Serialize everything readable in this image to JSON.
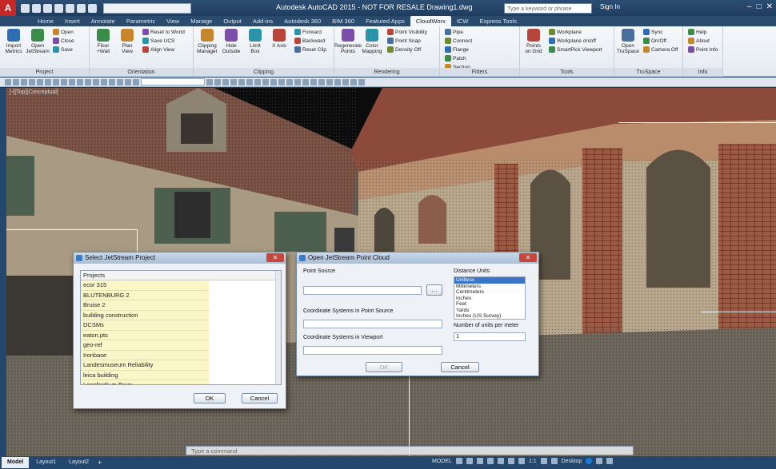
{
  "titlebar": {
    "app_letter": "A",
    "title": "Autodesk AutoCAD 2015 - NOT FOR RESALE   Drawing1.dwg",
    "search_placeholder": "Type a keyword or phrase",
    "signin": "Sign In"
  },
  "tabs": [
    "Home",
    "Insert",
    "Annotate",
    "Parametric",
    "View",
    "Manage",
    "Output",
    "Add-ins",
    "Autodesk 360",
    "BIM 360",
    "Featured Apps",
    "CloudWorx",
    "ICW",
    "Express Tools"
  ],
  "active_tab": "CloudWorx",
  "ribbon": {
    "groups": [
      {
        "title": "Project",
        "big": [
          "Import Metrics",
          "Open JetStream"
        ],
        "small": [
          "Open",
          "Close",
          "Save"
        ]
      },
      {
        "title": "Orientation",
        "big": [
          "Floor +Wall",
          "Plan View"
        ],
        "small": [
          "Reset to World",
          "Save UCS",
          "Align View"
        ]
      },
      {
        "title": "Clipping",
        "big": [
          "Clipping Manager",
          "Hide Outside",
          "Limit Box",
          "X Axis"
        ],
        "small": [
          "Forward",
          "Backward",
          "Reset Clip"
        ]
      },
      {
        "title": "Rendering",
        "big": [
          "Regenerate Points",
          "Color Mapping"
        ],
        "small": [
          "Point Visibility",
          "Point Snap",
          "Density Off"
        ]
      },
      {
        "title": "Fitters",
        "big": [],
        "small": [
          "Pipe",
          "Connect",
          "Flange",
          "Patch",
          "Section"
        ]
      },
      {
        "title": "Tools",
        "big": [
          "Points on Grid"
        ],
        "small": [
          "Workplane",
          "Workplane on/off",
          "SmartPick Viewport"
        ]
      },
      {
        "title": "TruSpace",
        "big": [
          "Open TruSpace"
        ],
        "small": [
          "Sync",
          "On/Off",
          "Camera Off"
        ]
      },
      {
        "title": "Info",
        "big": [],
        "small": [
          "Help",
          "About",
          "Point Info"
        ]
      }
    ]
  },
  "viewport": {
    "label": "[-][Top][Conceptual]"
  },
  "select_dialog": {
    "title": "Select JetStream Project",
    "header": "Projects",
    "items": [
      "ecor 315",
      "BLUTENBURG 2",
      "Bruise 2",
      "building construction",
      "DCSMs",
      "eaton.pts",
      "geo-ref",
      "Ironbase",
      "Landesmuseum Reliability",
      "leica building",
      "Longfordium Town"
    ],
    "ok": "OK",
    "cancel": "Cancel"
  },
  "open_dialog": {
    "title": "Open JetStream Point Cloud",
    "point_source_label": "Point Source",
    "coord_source_label": "Coordinate Systems in Point Source",
    "coord_viewport_label": "Coordinate Systems in Viewport",
    "distance_units_label": "Distance Units",
    "units": [
      "Unitless",
      "Millimeters",
      "Centimeters",
      "Inches",
      "Feet",
      "Yards",
      "Inches (US Survey)"
    ],
    "selected_unit": "Unitless",
    "units_per_meter_label": "Number of units per meter",
    "units_per_meter_value": "1",
    "ok": "OK",
    "cancel": "Cancel"
  },
  "command_line": {
    "placeholder": "Type a command"
  },
  "layout_tabs": [
    "Model",
    "Layout1",
    "Layout2"
  ],
  "status": {
    "model": "MODEL",
    "scale": "1:1",
    "workspace": "Desktop"
  }
}
